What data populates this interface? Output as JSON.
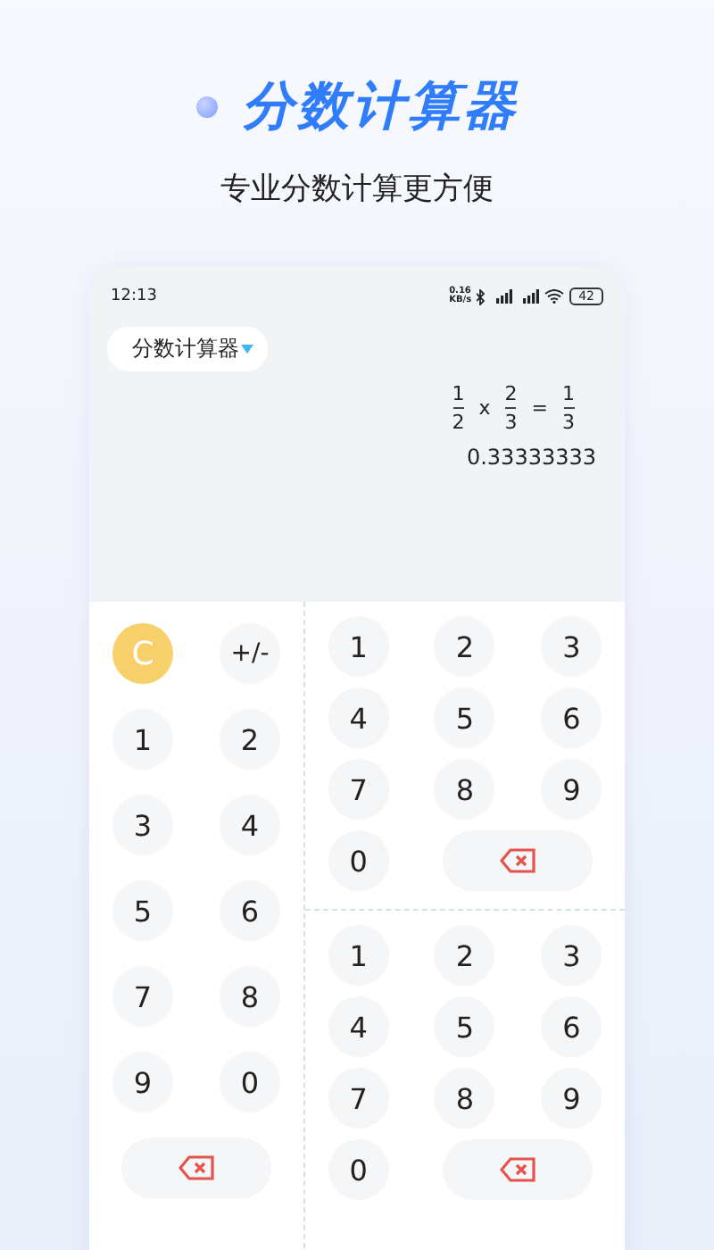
{
  "header": {
    "title": "分数计算器",
    "subtitle": "专业分数计算更方便"
  },
  "status_bar": {
    "time": "12:13",
    "net_speed": "0.16\nKB/s",
    "battery": "42"
  },
  "mode_dropdown": {
    "label": "分数计算器"
  },
  "display": {
    "expression": [
      {
        "kind": "fraction",
        "numerator": "1",
        "denominator": "2"
      },
      {
        "kind": "operator",
        "text": "x"
      },
      {
        "kind": "fraction",
        "numerator": "2",
        "denominator": "3"
      },
      {
        "kind": "operator",
        "text": "="
      },
      {
        "kind": "fraction",
        "numerator": "1",
        "denominator": "3"
      }
    ],
    "decimal": "0.33333333"
  },
  "left_pad": [
    {
      "kind": "clear",
      "label": "C"
    },
    {
      "kind": "key",
      "label": "+/-"
    },
    {
      "kind": "key",
      "label": "1"
    },
    {
      "kind": "key",
      "label": "2"
    },
    {
      "kind": "key",
      "label": "3"
    },
    {
      "kind": "key",
      "label": "4"
    },
    {
      "kind": "key",
      "label": "5"
    },
    {
      "kind": "key",
      "label": "6"
    },
    {
      "kind": "key",
      "label": "7"
    },
    {
      "kind": "key",
      "label": "8"
    },
    {
      "kind": "key",
      "label": "9"
    },
    {
      "kind": "key",
      "label": "0"
    },
    {
      "kind": "backspace"
    }
  ],
  "right_pads": [
    {
      "keys": [
        {
          "kind": "key",
          "label": "1"
        },
        {
          "kind": "key",
          "label": "2"
        },
        {
          "kind": "key",
          "label": "3"
        },
        {
          "kind": "key",
          "label": "4"
        },
        {
          "kind": "key",
          "label": "5"
        },
        {
          "kind": "key",
          "label": "6"
        },
        {
          "kind": "key",
          "label": "7"
        },
        {
          "kind": "key",
          "label": "8"
        },
        {
          "kind": "key",
          "label": "9"
        },
        {
          "kind": "key",
          "label": "0"
        },
        {
          "kind": "backspace"
        }
      ]
    },
    {
      "keys": [
        {
          "kind": "key",
          "label": "1"
        },
        {
          "kind": "key",
          "label": "2"
        },
        {
          "kind": "key",
          "label": "3"
        },
        {
          "kind": "key",
          "label": "4"
        },
        {
          "kind": "key",
          "label": "5"
        },
        {
          "kind": "key",
          "label": "6"
        },
        {
          "kind": "key",
          "label": "7"
        },
        {
          "kind": "key",
          "label": "8"
        },
        {
          "kind": "key",
          "label": "9"
        },
        {
          "kind": "key",
          "label": "0"
        },
        {
          "kind": "backspace"
        }
      ]
    }
  ]
}
